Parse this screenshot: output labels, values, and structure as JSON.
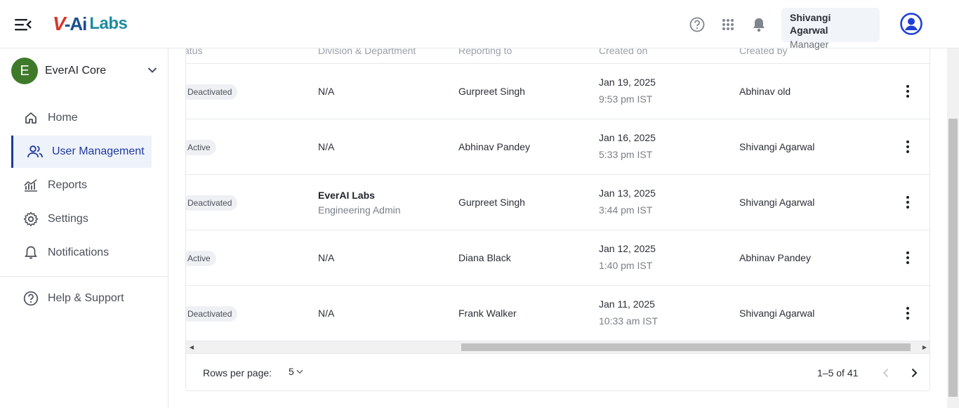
{
  "header": {
    "logo": {
      "v": "V",
      "ai": "-Ai",
      "labs": "Labs"
    },
    "user": {
      "name": "Shivangi Agarwal",
      "role": "Manager"
    },
    "icons": [
      "menu-collapse-icon",
      "help-icon",
      "apps-grid-icon",
      "bell-icon",
      "account-icon"
    ]
  },
  "sidebar": {
    "org": {
      "initial": "E",
      "name": "EverAI Core"
    },
    "items": [
      {
        "label": "Home",
        "icon": "home-icon"
      },
      {
        "label": "User Management",
        "icon": "users-icon",
        "active": true
      },
      {
        "label": "Reports",
        "icon": "chart-icon"
      },
      {
        "label": "Settings",
        "icon": "gear-icon"
      },
      {
        "label": "Notifications",
        "icon": "bell-outline-icon"
      },
      {
        "label": "Help & Support",
        "icon": "help-circle-icon"
      }
    ]
  },
  "table": {
    "columns": {
      "status": "atus",
      "division": "Division & Department",
      "reporting": "Reporting to",
      "created_on": "Created on",
      "created_by": "Created by"
    },
    "rows": [
      {
        "status": "Deactivated",
        "division": "N/A",
        "division_sub": "",
        "reporting": "Gurpreet Singh",
        "date": "Jan 19, 2025",
        "time": "9:53 pm IST",
        "created_by": "Abhinav old"
      },
      {
        "status": "Active",
        "division": "N/A",
        "division_sub": "",
        "reporting": "Abhinav Pandey",
        "date": "Jan 16, 2025",
        "time": "5:33 pm IST",
        "created_by": "Shivangi Agarwal"
      },
      {
        "status": "Deactivated",
        "division": "EverAI Labs",
        "division_sub": "Engineering Admin",
        "reporting": "Gurpreet Singh",
        "date": "Jan 13, 2025",
        "time": "3:44 pm IST",
        "created_by": "Shivangi Agarwal"
      },
      {
        "status": "Active",
        "division": "N/A",
        "division_sub": "",
        "reporting": "Diana Black",
        "date": "Jan 12, 2025",
        "time": "1:40 pm IST",
        "created_by": "Abhinav Pandey"
      },
      {
        "status": "Deactivated",
        "division": "N/A",
        "division_sub": "",
        "reporting": "Frank Walker",
        "date": "Jan 11, 2025",
        "time": "10:33 am IST",
        "created_by": "Shivangi Agarwal"
      }
    ]
  },
  "pagination": {
    "rows_per_page_label": "Rows per page:",
    "rows_per_page": "5",
    "range": "1–5 of 41"
  },
  "colors": {
    "accent": "#1e3a9e",
    "org_badge": "#3f7a2a",
    "logo_red": "#d9362c",
    "logo_teal": "#1d8ca0"
  }
}
